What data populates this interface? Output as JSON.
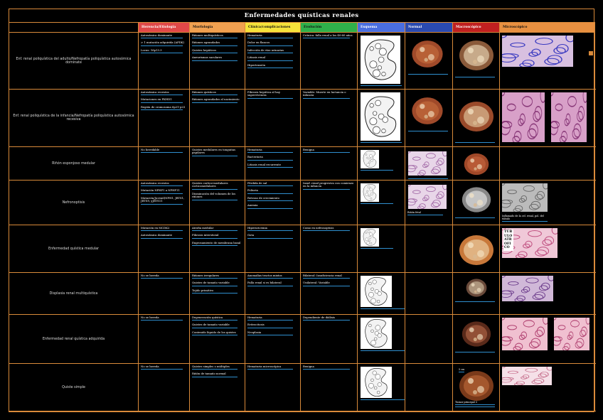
{
  "title": "Enfermedades quísticas renales",
  "headers": [
    "Herencia/Etiología",
    "Morfología",
    "Clínica/complicaciones",
    "Evolución",
    "Esquema",
    "Normal",
    "Macroscópico",
    "Microscópico"
  ],
  "header_colors": [
    "#e04848",
    "#f0a050",
    "#f5e23a",
    "#2fb04a",
    "#4a6ee0",
    "#2a4ab0",
    "#c02020",
    "#e89040"
  ],
  "rows": [
    {
      "name": "Enf. renal poliquística del adulto/Nefropatía poliquística autosómica dominate",
      "herencia": [
        "Autosómica dominante",
        "> 1 mutación adquirida (APDK)",
        "Locus: 16p13.3"
      ],
      "morfologia": [
        "Riñones multiquísticos",
        "Riñones agrandados",
        "Quistes hepáticos",
        "Aneurismas saculares"
      ],
      "clinica": [
        "Hematuria",
        "Dolor en flancos",
        "Infección de vías urinarias",
        "Litiasis renal",
        "Hipertensión"
      ],
      "evolucion": [
        "Crónica: falla renal a los 40-60 años"
      ],
      "captions": {}
    },
    {
      "name": "Enf. renal poliquística de la infancia/Nefropatía poliquística autosómica recesiva",
      "herencia": [
        "Autosómica recesiva",
        "Mutaciones en PKHD1",
        "Región de cromosoma 6p21-p23"
      ],
      "morfologia": [
        "Riñones quísticos",
        "Riñones agrandados al nacimiento"
      ],
      "clinica": [
        "Fibrosis hepática al hay supervivencia"
      ],
      "evolucion": [
        "Variable: Muerte en lactancia o infancia"
      ],
      "captions": {}
    },
    {
      "name": "Riñón esponjoso medular",
      "herencia": [
        "No heredable"
      ],
      "morfologia": [
        "Quistes medulares en tonguitas papilares"
      ],
      "clinica": [
        "Hematuria",
        "Bacteriuria",
        "Litiasis renal recurrente"
      ],
      "evolucion": [
        "Benigna"
      ],
      "captions": {}
    },
    {
      "name": "Nefronoptisis",
      "herencia": [
        "Autosómica recesiva",
        "Mutación NPHP1 a NPHP11",
        "Mutación/Juvenil(NPH1, JBTS1, JBTS9, yJBTS11"
      ],
      "morfologia": [
        "Quistes cortico-medulares corticomedulares",
        "Disminución del volumen de los riñones"
      ],
      "clinica": [
        "Pérdida de sal",
        "Poliuria",
        "Retraso de crecimiento",
        "Anemia"
      ],
      "evolucion": [
        "Insuf. renal progresiva con comienzo en la infancia"
      ],
      "captions": {
        "normal": "Riñón fetal",
        "micro": "Inflamado de la cel. renal, pol. del túbulo"
      }
    },
    {
      "name": "Enfermedad quística medular",
      "herencia": [
        "Mutación en MCDK2",
        "Autosómica dominante"
      ],
      "morfologia": [
        "Atrofia medular",
        "Fibrosis intersticial",
        "Engrosamiento de membrana basal"
      ],
      "clinica": [
        "Hiperuricemia",
        "Gota"
      ],
      "evolucion": [
        "Como en nefronoptisis"
      ],
      "captions": {
        "micro_label": "TÚBULO ATROFICO"
      }
    },
    {
      "name": "Displasia renal multiquística",
      "herencia": [
        "No se hereda"
      ],
      "morfologia": [
        "Riñones irregulares",
        "Quistes de tamaño variable",
        "Tejido primitivo"
      ],
      "clinica": [
        "Anomalías tractos mixtos",
        "Falla renal si es bilateral"
      ],
      "evolucion": [
        "Bilateral: Insuficiencia renal",
        "Unilateral: Variable"
      ],
      "captions": {}
    },
    {
      "name": "Enfermedad renal quística adquirida",
      "herencia": [
        "No se hereda"
      ],
      "morfologia": [
        "Degeneración quística",
        "Quistes de tamaño variable",
        "Contenido líquido de los quistes"
      ],
      "clinica": [
        "Hematuria",
        "Eritrocitosis",
        "Neoplasia"
      ],
      "evolucion": [
        "Dependiente de diálisis"
      ],
      "captions": {}
    },
    {
      "name": "Quiste simple",
      "herencia": [
        "No se hereda"
      ],
      "morfologia": [
        "Quistes simples o múltiples",
        "Riñón de tamaño normal"
      ],
      "clinica": [
        "Hematuria microscópica"
      ],
      "evolucion": [
        "Benigna"
      ],
      "captions": {
        "macro_scale": "5 cm",
        "macro": "Tumor principal 3"
      }
    }
  ]
}
